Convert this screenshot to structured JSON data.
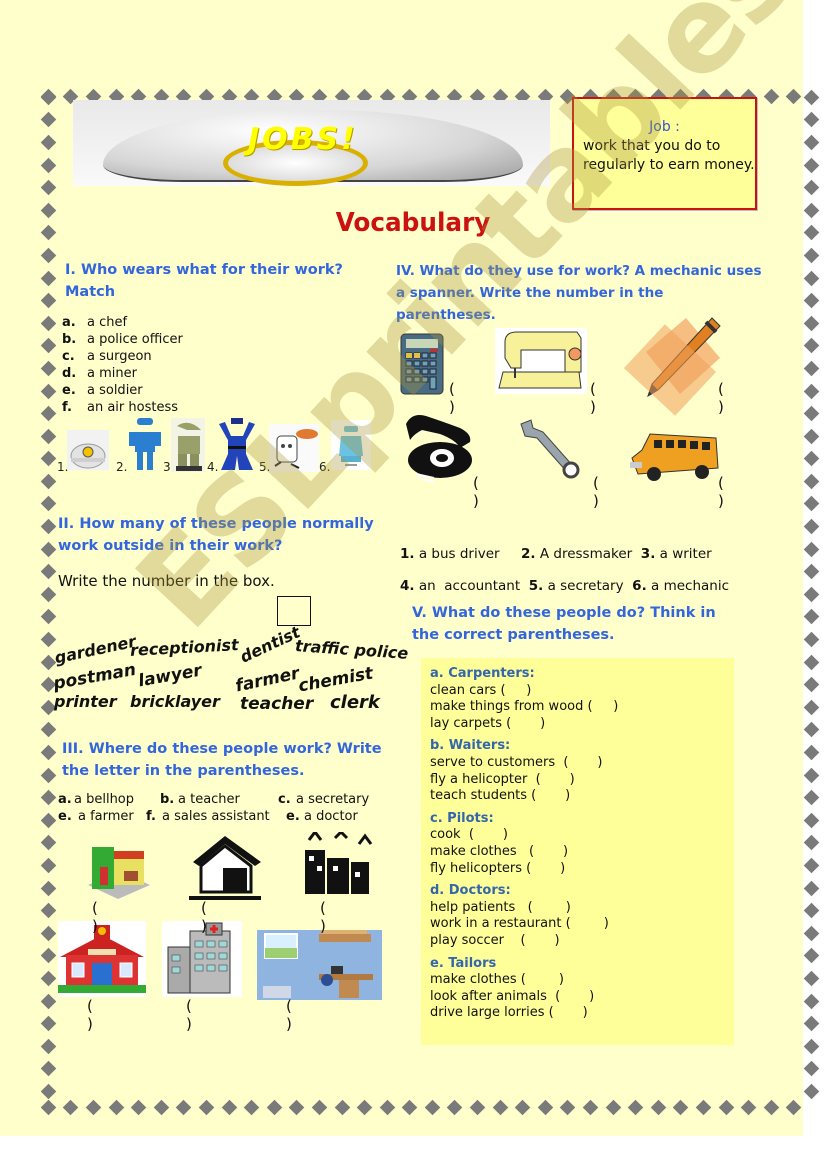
{
  "header": {
    "banner_text": "JOBS!",
    "definition": {
      "term": "Job :",
      "text": "work that you do to regularly to earn money."
    },
    "title": "Vocabulary"
  },
  "colors": {
    "page_bg": "#ffffcc",
    "heading_blue": "#3366dd",
    "title_red": "#cc1111",
    "box_yellow": "#ffff99",
    "border_diamond": "#7a7a7a"
  },
  "section1": {
    "heading": "I. Who wears what for their work? Match",
    "items": [
      {
        "letter": "a.",
        "text": "a chef"
      },
      {
        "letter": "b.",
        "text": "a police officer"
      },
      {
        "letter": "c.",
        "text": "a surgeon"
      },
      {
        "letter": "d.",
        "text": "a miner"
      },
      {
        "letter": "e.",
        "text": "a soldier"
      },
      {
        "letter": "f.",
        "text": "an air hostess"
      }
    ],
    "pictures": [
      {
        "num": "1.",
        "icon": "miner-helmet-icon"
      },
      {
        "num": "2.",
        "icon": "surgeon-uniform-icon"
      },
      {
        "num": "3",
        "icon": "soldier-uniform-icon"
      },
      {
        "num": "4.",
        "icon": "police-uniform-icon"
      },
      {
        "num": "5.",
        "icon": "chef-icon"
      },
      {
        "num": "6.",
        "icon": "air-hostess-uniform-icon"
      }
    ]
  },
  "section2": {
    "heading": "II. How many of these people normally work outside in their work?",
    "instruction": "Write the number in the box.",
    "answer_box": "",
    "words": [
      "gardener",
      "receptionist",
      "dentist",
      "traffic police",
      "postman",
      "lawyer",
      "farmer",
      "chemist",
      "printer",
      "bricklayer",
      "teacher",
      "clerk"
    ]
  },
  "section3": {
    "heading": "III. Where do these people work? Write the letter in the parentheses.",
    "options_row1": [
      {
        "letter": "a.",
        "text": "a bellhop"
      },
      {
        "letter": "b.",
        "text": "a teacher"
      },
      {
        "letter": "c.",
        "text": "a secretary"
      }
    ],
    "options_row2": [
      {
        "letter": "e.",
        "text": "a farmer"
      },
      {
        "letter": "f.",
        "text": "a sales assistant"
      },
      {
        "letter": "e.",
        "text": "a doctor"
      }
    ],
    "places": [
      "shop-icon",
      "barn-icon",
      "hotel-city-icon",
      "school-icon",
      "hospital-icon",
      "office-room-icon"
    ],
    "paren": "( )"
  },
  "section4": {
    "heading": "IV. What do they use for work? A mechanic uses a spanner. Write the number in the parentheses.",
    "tools": [
      "calculator-icon",
      "sewing-machine-icon",
      "pencil-icon",
      "telephone-icon",
      "spanner-icon",
      "school-bus-icon"
    ],
    "paren": "( )",
    "options_row1": [
      {
        "num": "1.",
        "text": "a bus driver"
      },
      {
        "num": "2.",
        "text": "A dressmaker"
      },
      {
        "num": "3.",
        "text": "a writer"
      }
    ],
    "options_row2": [
      {
        "num": "4.",
        "text": "an  accountant"
      },
      {
        "num": "5.",
        "text": "a secretary"
      },
      {
        "num": "6.",
        "text": "a mechanic"
      }
    ]
  },
  "section5": {
    "heading": "V. What do these people do? Think in the correct parentheses.",
    "groups": [
      {
        "title": "a. Carpenters:",
        "lines": [
          "clean cars (     )",
          "make things from wood (     )",
          "lay carpets (       )"
        ]
      },
      {
        "title": "b. Waiters:",
        "lines": [
          "serve to customers  (       )",
          "fly a helicopter  (       )",
          "teach students (       )"
        ]
      },
      {
        "title": "c. Pilots:",
        "lines": [
          "cook  (       )",
          "make clothes   (       )",
          "fly helicopters (       )"
        ]
      },
      {
        "title": "d. Doctors:",
        "lines": [
          "help patients   (        )",
          "work in a restaurant (        )",
          "play soccer    (       )"
        ]
      },
      {
        "title": "e. Tailors",
        "lines": [
          "make clothes (        )",
          "look after animals  (       )",
          "drive large lorries (       )"
        ]
      }
    ]
  },
  "watermark": "ESLprintables.com"
}
